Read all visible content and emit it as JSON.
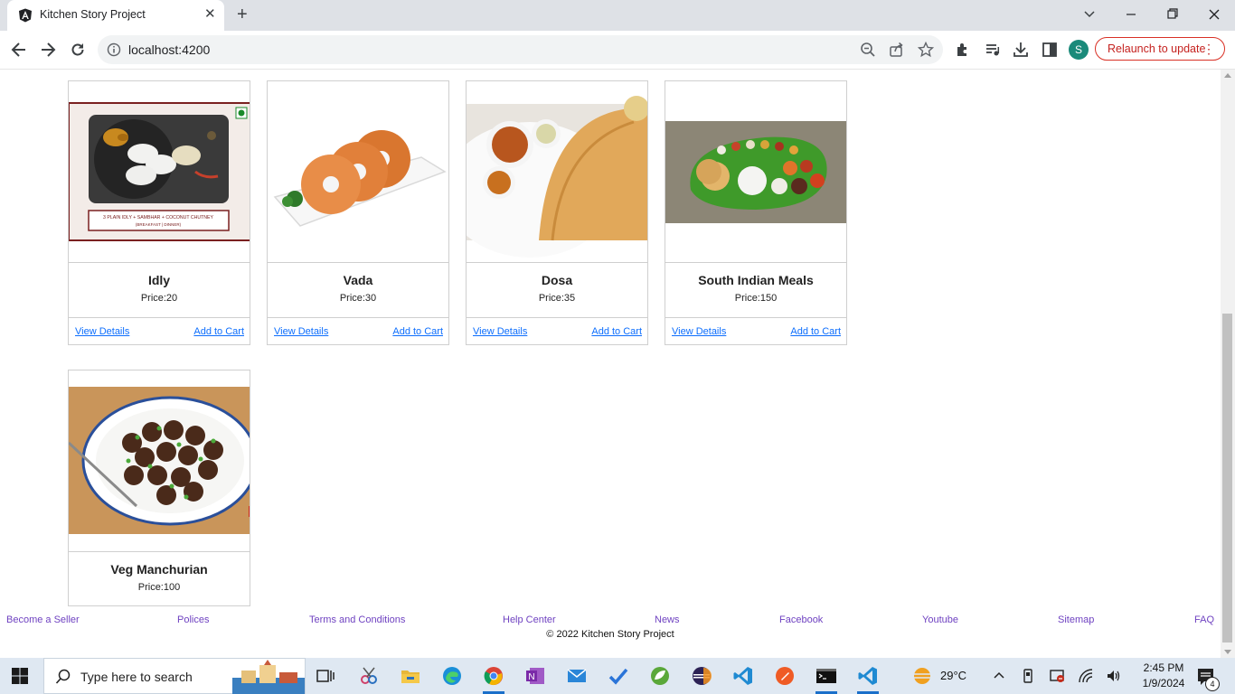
{
  "browser": {
    "tab_title": "Kitchen Story Project",
    "url": "localhost:4200",
    "avatar_letter": "S",
    "relaunch_label": "Relaunch to update"
  },
  "products": [
    {
      "name": "Idly",
      "price": "Price:20",
      "view": "View Details",
      "cart": "Add to Cart"
    },
    {
      "name": "Vada",
      "price": "Price:30",
      "view": "View Details",
      "cart": "Add to Cart"
    },
    {
      "name": "Dosa",
      "price": "Price:35",
      "view": "View Details",
      "cart": "Add to Cart"
    },
    {
      "name": "South Indian Meals",
      "price": "Price:150",
      "view": "View Details",
      "cart": "Add to Cart"
    },
    {
      "name": "Veg Manchurian",
      "price": "Price:100"
    }
  ],
  "idly_banner_text": "3 PLAIN IDLY + SAMBHAR + COCONUT CHUTNEY",
  "idly_banner_sub": "(BREAKFAST | DINNER)",
  "footer": {
    "links": [
      "Become a Seller",
      "Polices",
      "Terms and Conditions",
      "Help Center",
      "News",
      "Facebook",
      "Youtube",
      "Sitemap",
      "FAQ"
    ],
    "copyright": "© 2022 Kitchen Story Project"
  },
  "taskbar": {
    "search_placeholder": "Type here to search",
    "temperature": "29°C",
    "time": "2:45 PM",
    "date": "1/9/2024",
    "notification_count": "4"
  },
  "colors": {
    "link": "#0d6efd",
    "footer_link": "#6f42c1",
    "relaunch": "#c5221f"
  }
}
